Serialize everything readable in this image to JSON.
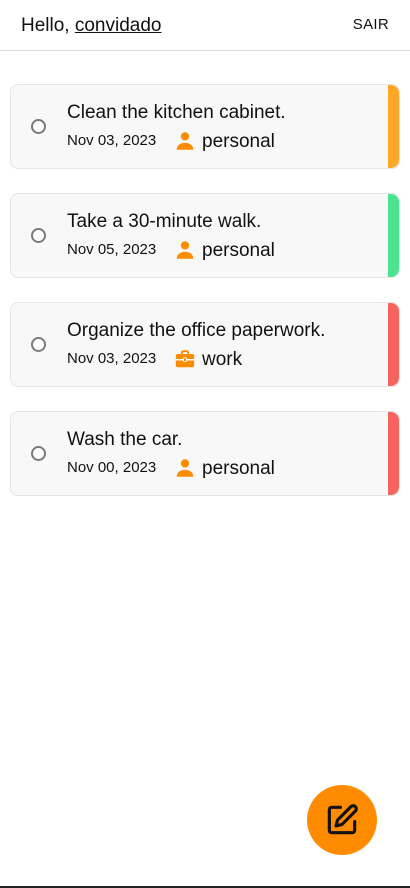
{
  "header": {
    "greeting": "Hello,",
    "user": "convidado",
    "logout_label": "SAIR"
  },
  "tasks": [
    {
      "title": "Clean the kitchen cabinet.",
      "date": "Nov 03, 2023",
      "category": "personal",
      "category_icon": "person-icon",
      "priority_color": "#ffa726"
    },
    {
      "title": "Take a 30-minute walk.",
      "date": "Nov 05, 2023",
      "category": "personal",
      "category_icon": "person-icon",
      "priority_color": "#4be38f"
    },
    {
      "title": "Organize the office paperwork.",
      "date": "Nov 03, 2023",
      "category": "work",
      "category_icon": "briefcase-icon",
      "priority_color": "#f6645f"
    },
    {
      "title": "Wash the car.",
      "date": "Nov 00, 2023",
      "category": "personal",
      "category_icon": "person-icon",
      "priority_color": "#f6645f"
    }
  ],
  "fab": {
    "icon": "edit-icon",
    "color": "#ff8c00"
  },
  "colors": {
    "accent": "#ff8c00",
    "icon": "#fb8c00"
  }
}
